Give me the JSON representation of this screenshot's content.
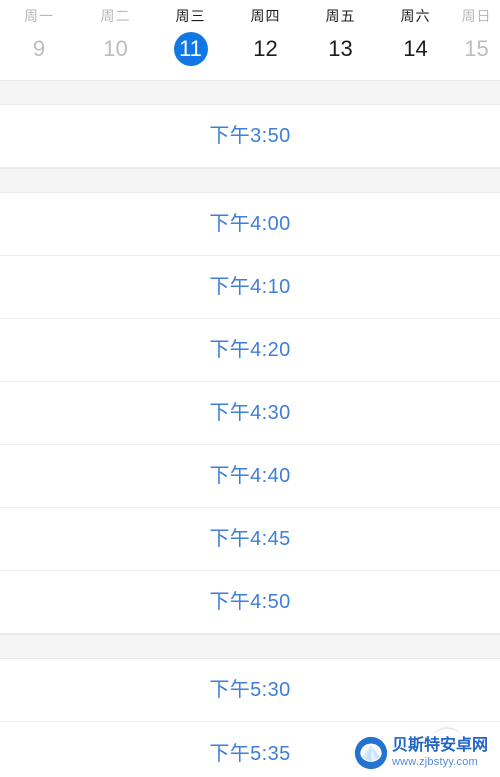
{
  "week_strip": {
    "days": [
      {
        "dow": "周一",
        "num": "9",
        "state": "past"
      },
      {
        "dow": "周二",
        "num": "10",
        "state": "past"
      },
      {
        "dow": "周三",
        "num": "11",
        "state": "selected"
      },
      {
        "dow": "周四",
        "num": "12",
        "state": "normal"
      },
      {
        "dow": "周五",
        "num": "13",
        "state": "normal"
      },
      {
        "dow": "周六",
        "num": "14",
        "state": "normal"
      },
      {
        "dow": "周日",
        "num": "15",
        "state": "past"
      }
    ],
    "selected_index": 2,
    "selected_accent": "#1177e4"
  },
  "slot_list": {
    "time_color": "#3f7fd6",
    "band_color": "#f5f5f6",
    "groups": [
      {
        "leading_band": true,
        "slots": [
          {
            "time": "下午3:50"
          }
        ]
      },
      {
        "leading_band": true,
        "slots": [
          {
            "time": "下午4:00"
          },
          {
            "time": "下午4:10"
          },
          {
            "time": "下午4:20"
          },
          {
            "time": "下午4:30"
          },
          {
            "time": "下午4:40"
          },
          {
            "time": "下午4:45"
          },
          {
            "time": "下午4:50"
          }
        ]
      },
      {
        "leading_band": true,
        "slots": [
          {
            "time": "下午5:30"
          },
          {
            "time": "下午5:35"
          }
        ]
      }
    ]
  },
  "watermark": {
    "title": "贝斯特安卓网",
    "url": "www.zjbstyy.com",
    "logo_color": "#1d6fd0"
  }
}
